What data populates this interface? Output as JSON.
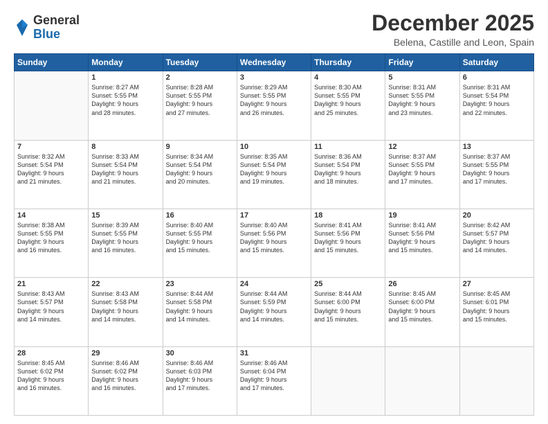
{
  "logo": {
    "general": "General",
    "blue": "Blue"
  },
  "title": "December 2025",
  "subtitle": "Belena, Castille and Leon, Spain",
  "header_days": [
    "Sunday",
    "Monday",
    "Tuesday",
    "Wednesday",
    "Thursday",
    "Friday",
    "Saturday"
  ],
  "weeks": [
    [
      {
        "day": "",
        "info": ""
      },
      {
        "day": "1",
        "info": "Sunrise: 8:27 AM\nSunset: 5:55 PM\nDaylight: 9 hours\nand 28 minutes."
      },
      {
        "day": "2",
        "info": "Sunrise: 8:28 AM\nSunset: 5:55 PM\nDaylight: 9 hours\nand 27 minutes."
      },
      {
        "day": "3",
        "info": "Sunrise: 8:29 AM\nSunset: 5:55 PM\nDaylight: 9 hours\nand 26 minutes."
      },
      {
        "day": "4",
        "info": "Sunrise: 8:30 AM\nSunset: 5:55 PM\nDaylight: 9 hours\nand 25 minutes."
      },
      {
        "day": "5",
        "info": "Sunrise: 8:31 AM\nSunset: 5:55 PM\nDaylight: 9 hours\nand 23 minutes."
      },
      {
        "day": "6",
        "info": "Sunrise: 8:31 AM\nSunset: 5:54 PM\nDaylight: 9 hours\nand 22 minutes."
      }
    ],
    [
      {
        "day": "7",
        "info": "Sunrise: 8:32 AM\nSunset: 5:54 PM\nDaylight: 9 hours\nand 21 minutes."
      },
      {
        "day": "8",
        "info": "Sunrise: 8:33 AM\nSunset: 5:54 PM\nDaylight: 9 hours\nand 21 minutes."
      },
      {
        "day": "9",
        "info": "Sunrise: 8:34 AM\nSunset: 5:54 PM\nDaylight: 9 hours\nand 20 minutes."
      },
      {
        "day": "10",
        "info": "Sunrise: 8:35 AM\nSunset: 5:54 PM\nDaylight: 9 hours\nand 19 minutes."
      },
      {
        "day": "11",
        "info": "Sunrise: 8:36 AM\nSunset: 5:54 PM\nDaylight: 9 hours\nand 18 minutes."
      },
      {
        "day": "12",
        "info": "Sunrise: 8:37 AM\nSunset: 5:55 PM\nDaylight: 9 hours\nand 17 minutes."
      },
      {
        "day": "13",
        "info": "Sunrise: 8:37 AM\nSunset: 5:55 PM\nDaylight: 9 hours\nand 17 minutes."
      }
    ],
    [
      {
        "day": "14",
        "info": "Sunrise: 8:38 AM\nSunset: 5:55 PM\nDaylight: 9 hours\nand 16 minutes."
      },
      {
        "day": "15",
        "info": "Sunrise: 8:39 AM\nSunset: 5:55 PM\nDaylight: 9 hours\nand 16 minutes."
      },
      {
        "day": "16",
        "info": "Sunrise: 8:40 AM\nSunset: 5:55 PM\nDaylight: 9 hours\nand 15 minutes."
      },
      {
        "day": "17",
        "info": "Sunrise: 8:40 AM\nSunset: 5:56 PM\nDaylight: 9 hours\nand 15 minutes."
      },
      {
        "day": "18",
        "info": "Sunrise: 8:41 AM\nSunset: 5:56 PM\nDaylight: 9 hours\nand 15 minutes."
      },
      {
        "day": "19",
        "info": "Sunrise: 8:41 AM\nSunset: 5:56 PM\nDaylight: 9 hours\nand 15 minutes."
      },
      {
        "day": "20",
        "info": "Sunrise: 8:42 AM\nSunset: 5:57 PM\nDaylight: 9 hours\nand 14 minutes."
      }
    ],
    [
      {
        "day": "21",
        "info": "Sunrise: 8:43 AM\nSunset: 5:57 PM\nDaylight: 9 hours\nand 14 minutes."
      },
      {
        "day": "22",
        "info": "Sunrise: 8:43 AM\nSunset: 5:58 PM\nDaylight: 9 hours\nand 14 minutes."
      },
      {
        "day": "23",
        "info": "Sunrise: 8:44 AM\nSunset: 5:58 PM\nDaylight: 9 hours\nand 14 minutes."
      },
      {
        "day": "24",
        "info": "Sunrise: 8:44 AM\nSunset: 5:59 PM\nDaylight: 9 hours\nand 14 minutes."
      },
      {
        "day": "25",
        "info": "Sunrise: 8:44 AM\nSunset: 6:00 PM\nDaylight: 9 hours\nand 15 minutes."
      },
      {
        "day": "26",
        "info": "Sunrise: 8:45 AM\nSunset: 6:00 PM\nDaylight: 9 hours\nand 15 minutes."
      },
      {
        "day": "27",
        "info": "Sunrise: 8:45 AM\nSunset: 6:01 PM\nDaylight: 9 hours\nand 15 minutes."
      }
    ],
    [
      {
        "day": "28",
        "info": "Sunrise: 8:45 AM\nSunset: 6:02 PM\nDaylight: 9 hours\nand 16 minutes."
      },
      {
        "day": "29",
        "info": "Sunrise: 8:46 AM\nSunset: 6:02 PM\nDaylight: 9 hours\nand 16 minutes."
      },
      {
        "day": "30",
        "info": "Sunrise: 8:46 AM\nSunset: 6:03 PM\nDaylight: 9 hours\nand 17 minutes."
      },
      {
        "day": "31",
        "info": "Sunrise: 8:46 AM\nSunset: 6:04 PM\nDaylight: 9 hours\nand 17 minutes."
      },
      {
        "day": "",
        "info": ""
      },
      {
        "day": "",
        "info": ""
      },
      {
        "day": "",
        "info": ""
      }
    ]
  ]
}
